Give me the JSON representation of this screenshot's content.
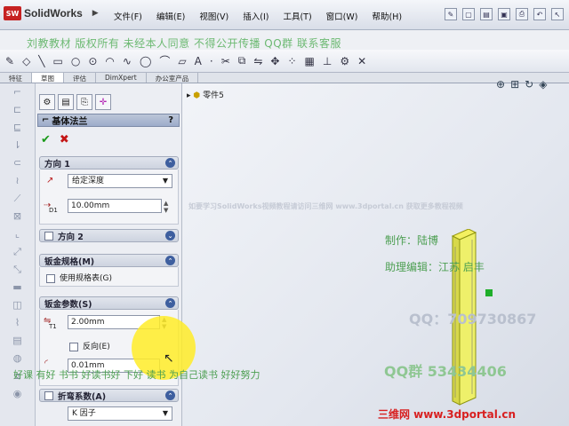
{
  "app": {
    "brand": "SolidWorks",
    "logo_text": "SW"
  },
  "menu": [
    "文件(F)",
    "编辑(E)",
    "视图(V)",
    "插入(I)",
    "工具(T)",
    "窗口(W)",
    "帮助(H)"
  ],
  "banner": "刘教教材  版权所有  未经本人同意  不得公开传播  QQ群  联系客服",
  "tabs": [
    "特征",
    "草图",
    "评估",
    "DimXpert",
    "办公室产品"
  ],
  "tree": {
    "item": "零件5"
  },
  "panel": {
    "title": "基体法兰",
    "help": "?",
    "dir1": {
      "header": "方向 1",
      "end_condition": "给定深度",
      "depth": "10.00mm",
      "depth_label": "D1"
    },
    "dir2": {
      "header": "方向 2"
    },
    "gauge": {
      "header": "钣金规格(M)",
      "use_table": "使用规格表(G)"
    },
    "params": {
      "header": "钣金参数(S)",
      "thickness": "2.00mm",
      "thickness_label": "T1",
      "reverse": "反向(E)",
      "radius": "0.01mm"
    },
    "bend": {
      "header": "折弯系数(A)",
      "type": "K 因子"
    }
  },
  "watermarks": {
    "author": "制作：陆博",
    "assistant": "助理编辑：江苏 启丰",
    "qq": "QQ：709730867",
    "qq_group": "QQ群 53434406",
    "bottom_line": "好课 有好 书书  好读书好  下好 读书  为自己读书 好好努力",
    "mid_line": "如要学习SolidWorks视频教程请访问三维网 www.3dportal.cn 获取更多教程视频",
    "site": "三维网 www.3dportal.cn"
  },
  "colors": {
    "accent": "#3e5f9f",
    "ok": "#1a9a1a",
    "cancel": "#c41616",
    "cursor": "#ffec28"
  }
}
